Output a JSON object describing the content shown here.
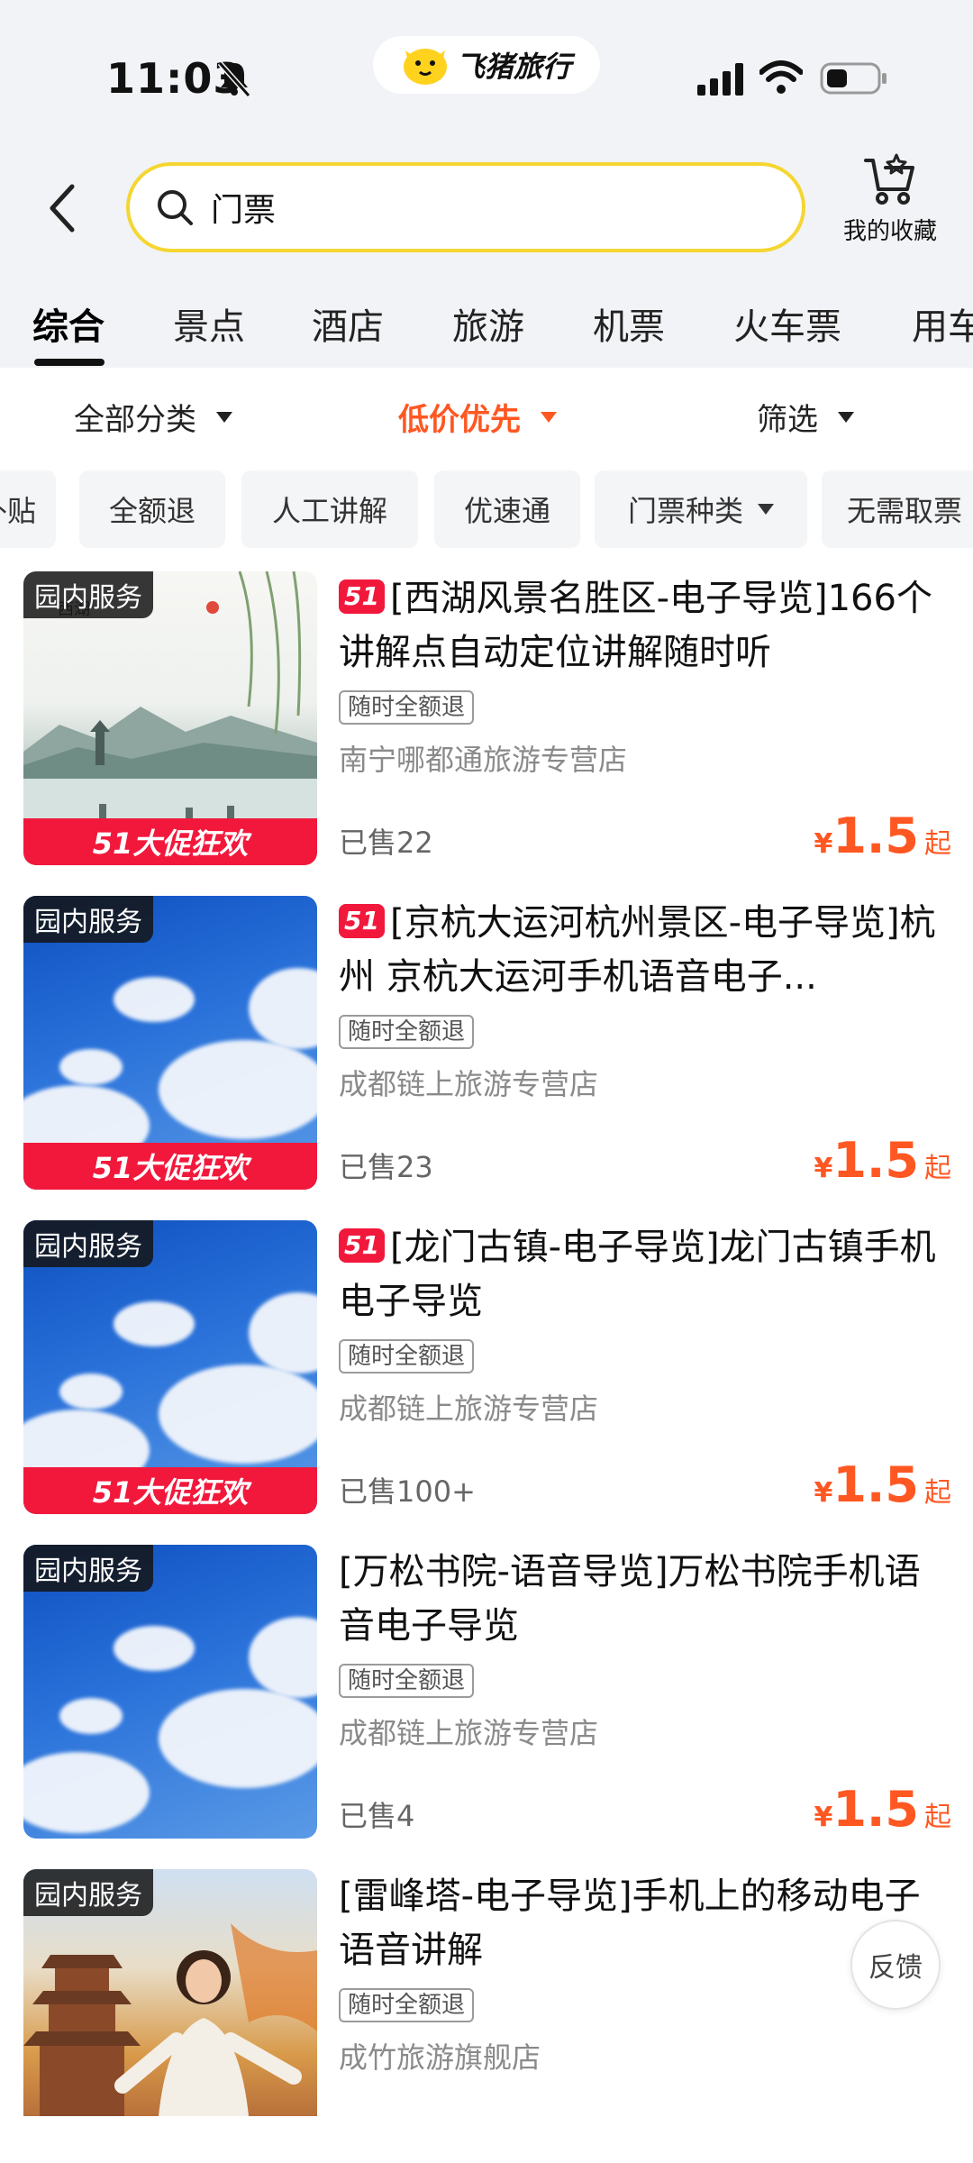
{
  "status_bar": {
    "time": "11:03"
  },
  "brand": {
    "name": "飞猪旅行",
    "brand_color": "#ffd21e"
  },
  "header": {
    "back_icon": "chevron-left-icon",
    "search_value": "门票",
    "favorites_label": "我的收藏"
  },
  "tabs": [
    {
      "label": "综合",
      "active": true
    },
    {
      "label": "景点"
    },
    {
      "label": "酒店"
    },
    {
      "label": "旅游"
    },
    {
      "label": "机票"
    },
    {
      "label": "火车票"
    },
    {
      "label": "用车"
    }
  ],
  "filters": [
    {
      "label": "全部分类"
    },
    {
      "label": "低价优先",
      "active": true
    },
    {
      "label": "筛选"
    }
  ],
  "chips": [
    "补贴",
    "全额退",
    "人工讲解",
    "优速通",
    "门票种类",
    "无需取票"
  ],
  "accent_color": "#ff5722",
  "promo_color": "#f2183c",
  "results": [
    {
      "badge": "园内服务",
      "promo": "51大促狂欢",
      "tag": "51",
      "title": "[西湖风景名胜区-电子导览]166个讲解点自动定位讲解随时听",
      "refund": "随时全额退",
      "shop": "南宁哪都通旅游专营店",
      "sold": "已售22",
      "currency": "¥",
      "price": "1.5",
      "price_suffix": "起"
    },
    {
      "badge": "园内服务",
      "promo": "51大促狂欢",
      "tag": "51",
      "title": "[京杭大运河杭州景区-电子导览]杭州 京杭大运河手机语音电子...",
      "refund": "随时全额退",
      "shop": "成都链上旅游专营店",
      "sold": "已售23",
      "currency": "¥",
      "price": "1.5",
      "price_suffix": "起"
    },
    {
      "badge": "园内服务",
      "promo": "51大促狂欢",
      "tag": "51",
      "title": "[龙门古镇-电子导览]龙门古镇手机电子导览",
      "refund": "随时全额退",
      "shop": "成都链上旅游专营店",
      "sold": "已售100+",
      "currency": "¥",
      "price": "1.5",
      "price_suffix": "起"
    },
    {
      "badge": "园内服务",
      "title": "[万松书院-语音导览]万松书院手机语音电子导览",
      "refund": "随时全额退",
      "shop": "成都链上旅游专营店",
      "sold": "已售4",
      "currency": "¥",
      "price": "1.5",
      "price_suffix": "起"
    },
    {
      "badge": "园内服务",
      "title": "[雷峰塔-电子导览]手机上的移动电子语音讲解",
      "refund": "随时全额退",
      "shop": "成竹旅游旗舰店"
    }
  ],
  "feedback_label": "反馈"
}
